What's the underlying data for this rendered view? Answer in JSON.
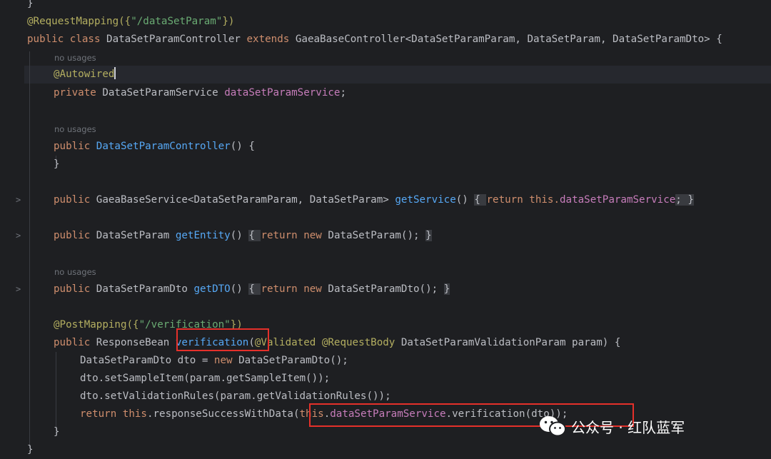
{
  "editor": {
    "hints": {
      "no_usages": "no usages"
    },
    "fold_marker": ">",
    "lines": {
      "l1_ann": "@RequestMapping({",
      "l1_str": "\"/dataSetParam\"",
      "l1_end": "})",
      "l2_kw1": "public class ",
      "l2_name": "DataSetParamController ",
      "l2_kw2": "extends ",
      "l2_rest": "GaeaBaseController<DataSetParamParam, DataSetParam, DataSetParamDto> {",
      "l3_ann": "@Autowired",
      "l4_kw": "private ",
      "l4_type": "DataSetParamService ",
      "l4_field": "dataSetParamService",
      "l4_end": ";",
      "l5_kw": "public ",
      "l5_method": "DataSetParamController",
      "l5_end": "() {",
      "l6": "}",
      "l7_kw": "public ",
      "l7_type": "GaeaBaseService<DataSetParamParam, DataSetParam> ",
      "l7_method": "getService",
      "l7_paren": "() ",
      "l7_ob": "{ ",
      "l7_kw2": "return this.",
      "l7_field": "dataSetParamService",
      "l7_semi": "; ",
      "l7_cb": "}",
      "l8_kw": "public ",
      "l8_type": "DataSetParam ",
      "l8_method": "getEntity",
      "l8_paren": "() ",
      "l8_ob": "{ ",
      "l8_kw2": "return new ",
      "l8_rest": "DataSetParam(); ",
      "l8_cb": "}",
      "l9_kw": "public ",
      "l9_type": "DataSetParamDto ",
      "l9_method": "getDTO",
      "l9_paren": "() ",
      "l9_ob": "{ ",
      "l9_kw2": "return new ",
      "l9_rest": "DataSetParamDto(); ",
      "l9_cb": "}",
      "l10_ann": "@PostMapping({",
      "l10_str": "\"/verification\"",
      "l10_end": "})",
      "l11_kw": "public ",
      "l11_type": "ResponseBean ",
      "l11_method": "verification",
      "l11_p": "(",
      "l11_ann": "@Validated @RequestBody ",
      "l11_rest": "DataSetParamValidationParam param) {",
      "l12_a": "DataSetParamDto dto = ",
      "l12_kw": "new ",
      "l12_b": "DataSetParamDto();",
      "l13": "dto.setSampleItem(param.getSampleItem());",
      "l14": "dto.setValidationRules(param.getValidationRules());",
      "l15_kw": "return this",
      "l15_a": ".responseSuccessWithData(",
      "l15_kw2": "this",
      "l15_dot": ".",
      "l15_field": "dataSetParamService",
      "l15_b": ".verification(dto));",
      "l16": "}",
      "l17": "}"
    }
  },
  "watermark": {
    "text": "公众号 · 红队蓝军",
    "icon": "wechat-icon"
  },
  "colors": {
    "background": "#1e1f22",
    "keyword": "#cf8e6d",
    "string": "#6aab73",
    "annotation": "#b3ae60",
    "field": "#c77dbb",
    "method": "#56a8f5",
    "highlight_box": "#e5302a"
  }
}
